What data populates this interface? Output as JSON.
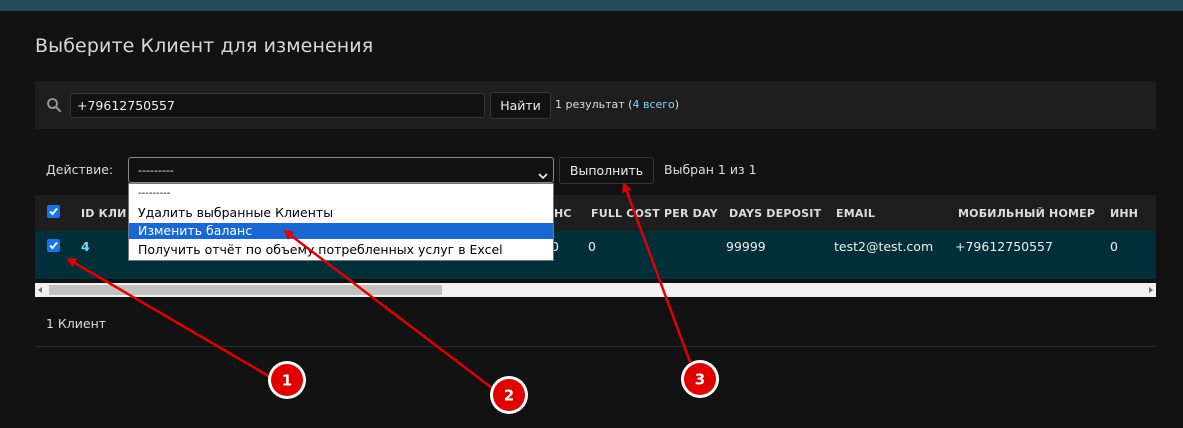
{
  "colors": {
    "header_bar": "#264b5d",
    "link": "#81d4fa",
    "selected_row": "#002f3a",
    "annotation": "#e00000"
  },
  "page": {
    "title": "Выберите Клиент для изменения"
  },
  "search": {
    "value": "+79612750557",
    "button_label": "Найти",
    "result_text": "1 результат (",
    "total_link": "4 всего",
    "result_suffix": ")"
  },
  "actions": {
    "label": "Действие:",
    "selected": "---------",
    "run_label": "Выполнить",
    "selected_count": "Выбран 1 из 1",
    "options": [
      "---------",
      "Удалить выбранные Клиенты",
      "Изменить баланс",
      "Получить отчёт по объему потребленных услуг в Excel"
    ],
    "highlighted_option": "Изменить баланс"
  },
  "table": {
    "columns": [
      "ID КЛИЕНТА",
      "НС",
      "FULL COST PER DAY",
      "DAYS DEPOSIT",
      "EMAIL",
      "МОБИЛЬНЫЙ НОМЕР",
      "ИНН"
    ],
    "columns_visible": [
      "ID КЛИ",
      "НС",
      "FULL COST PER DAY",
      "DAYS DEPOSIT",
      "EMAIL",
      "МОБИЛЬНЫЙ НОМЕР",
      "ИНН"
    ],
    "row": {
      "id": "4",
      "hc": "0",
      "full_cost": "0",
      "days_deposit": "99999",
      "email": "test2@test.com",
      "mobile": "+79612750557",
      "inn": "0"
    }
  },
  "paginator": {
    "text": "1 Клиент"
  },
  "annotations": [
    "1",
    "2",
    "3"
  ]
}
